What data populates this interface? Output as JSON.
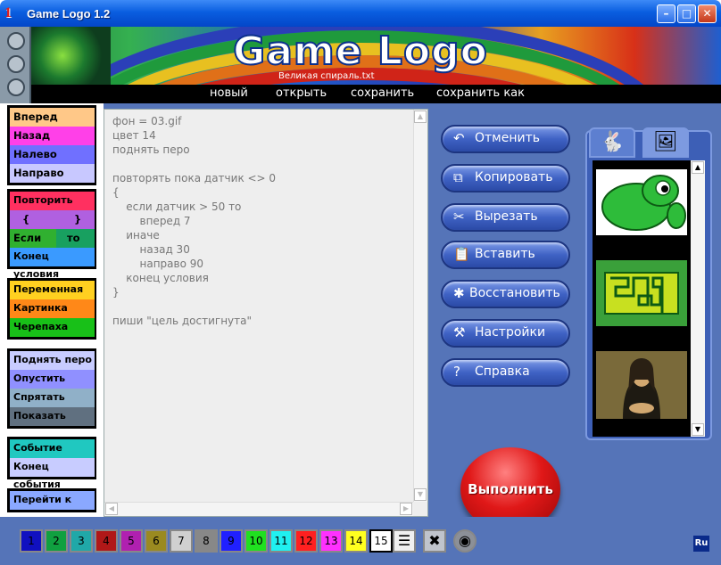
{
  "window": {
    "title": "Game Logo 1.2",
    "app_icon": "1"
  },
  "banner": {
    "logo": "Game Logo",
    "filename": "Великая спираль.txt"
  },
  "menu": {
    "new": "новый",
    "open": "открыть",
    "save": "сохранить",
    "save_as": "сохранить как"
  },
  "palette": {
    "forward": "Вперед",
    "back": "Назад",
    "left": "Налево",
    "right": "Направо",
    "repeat": "Повторить",
    "brace_open": "{",
    "brace_close": "}",
    "if": "Если",
    "then": "то",
    "end_if": "Конец условия",
    "variable": "Переменная",
    "picture": "Картинка",
    "turtle": "Черепаха",
    "pen_up": "Поднять перо",
    "pen_down": "Опустить перо",
    "hide": "Спрятать",
    "show": "Показать",
    "event": "Событие",
    "end_event": "Конец события",
    "goto": "Перейти к"
  },
  "editor": {
    "code": "фон = 03.gif\nцвет 14\nподнять перо\n\nповторять пока датчик <> 0\n{\n    если датчик > 50 то\n        вперед 7\n    иначе\n        назад 30\n        направо 90\n    конец условия\n}\n\nпиши \"цель достигнута\""
  },
  "actions": {
    "undo": "Отменить",
    "copy": "Копировать",
    "cut": "Вырезать",
    "paste": "Вставить",
    "restore": "Восстановить",
    "settings": "Настройки",
    "help": "Справка",
    "run": "Выполнить"
  },
  "colors": [
    {
      "n": "1",
      "c": "#1010c0"
    },
    {
      "n": "2",
      "c": "#10a040"
    },
    {
      "n": "3",
      "c": "#20a8a8"
    },
    {
      "n": "4",
      "c": "#b01818"
    },
    {
      "n": "5",
      "c": "#b020b0"
    },
    {
      "n": "6",
      "c": "#9a8a20"
    },
    {
      "n": "7",
      "c": "#d0d0d0"
    },
    {
      "n": "8",
      "c": "#888888"
    },
    {
      "n": "9",
      "c": "#2020ff"
    },
    {
      "n": "10",
      "c": "#20e020"
    },
    {
      "n": "11",
      "c": "#20f0f0"
    },
    {
      "n": "12",
      "c": "#ff2020"
    },
    {
      "n": "13",
      "c": "#ff30ff"
    },
    {
      "n": "14",
      "c": "#ffff20"
    },
    {
      "n": "15",
      "c": "#ffffff"
    }
  ],
  "status": {
    "lang": "Ru"
  }
}
